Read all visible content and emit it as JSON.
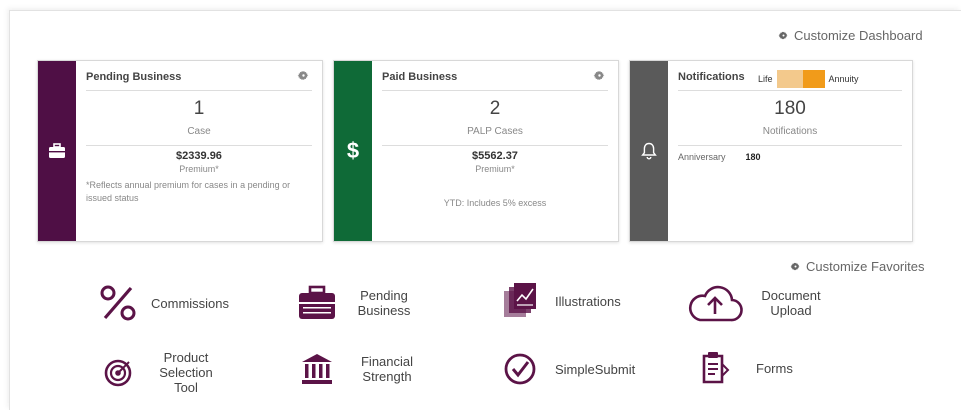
{
  "header": {
    "customize_dashboard": "Customize Dashboard"
  },
  "cards": {
    "pending": {
      "title": "Pending Business",
      "count": "1",
      "count_label": "Case",
      "amount": "$2339.96",
      "amount_label": "Premium*",
      "note": "*Reflects annual premium for cases in a pending or issued status",
      "strip_color": "#4f0f45",
      "icon": "briefcase-icon"
    },
    "paid": {
      "title": "Paid Business",
      "count": "2",
      "count_label": "PALP Cases",
      "amount": "$5562.37",
      "amount_label": "Premium*",
      "note": "YTD: Includes 5% excess",
      "strip_color": "#0f6a37",
      "icon": "dollar-icon"
    },
    "notifications": {
      "title": "Notifications",
      "toggle_left": "Life",
      "toggle_right": "Annuity",
      "toggle_selected": "Annuity",
      "count": "180",
      "count_label": "Notifications",
      "rows": [
        {
          "label": "Anniversary",
          "value": "180"
        }
      ],
      "strip_color": "#5a5a5a",
      "icon": "bell-icon"
    }
  },
  "favorites": {
    "customize_label": "Customize Favorites",
    "items": [
      {
        "label": "Commissions",
        "icon": "percent-icon"
      },
      {
        "label": "Pending Business",
        "icon": "briefcase-icon"
      },
      {
        "label": "Illustrations",
        "icon": "documents-icon"
      },
      {
        "label": "Document Upload",
        "icon": "cloud-upload-icon"
      },
      {
        "label": "Product Selection Tool",
        "icon": "target-icon"
      },
      {
        "label": "Financial Strength",
        "icon": "bank-icon"
      },
      {
        "label": "SimpleSubmit",
        "icon": "check-circle-icon"
      },
      {
        "label": "Forms",
        "icon": "clipboard-icon"
      }
    ]
  },
  "colors": {
    "accent": "#5b1347",
    "toggle_on": "#f19b1a"
  }
}
